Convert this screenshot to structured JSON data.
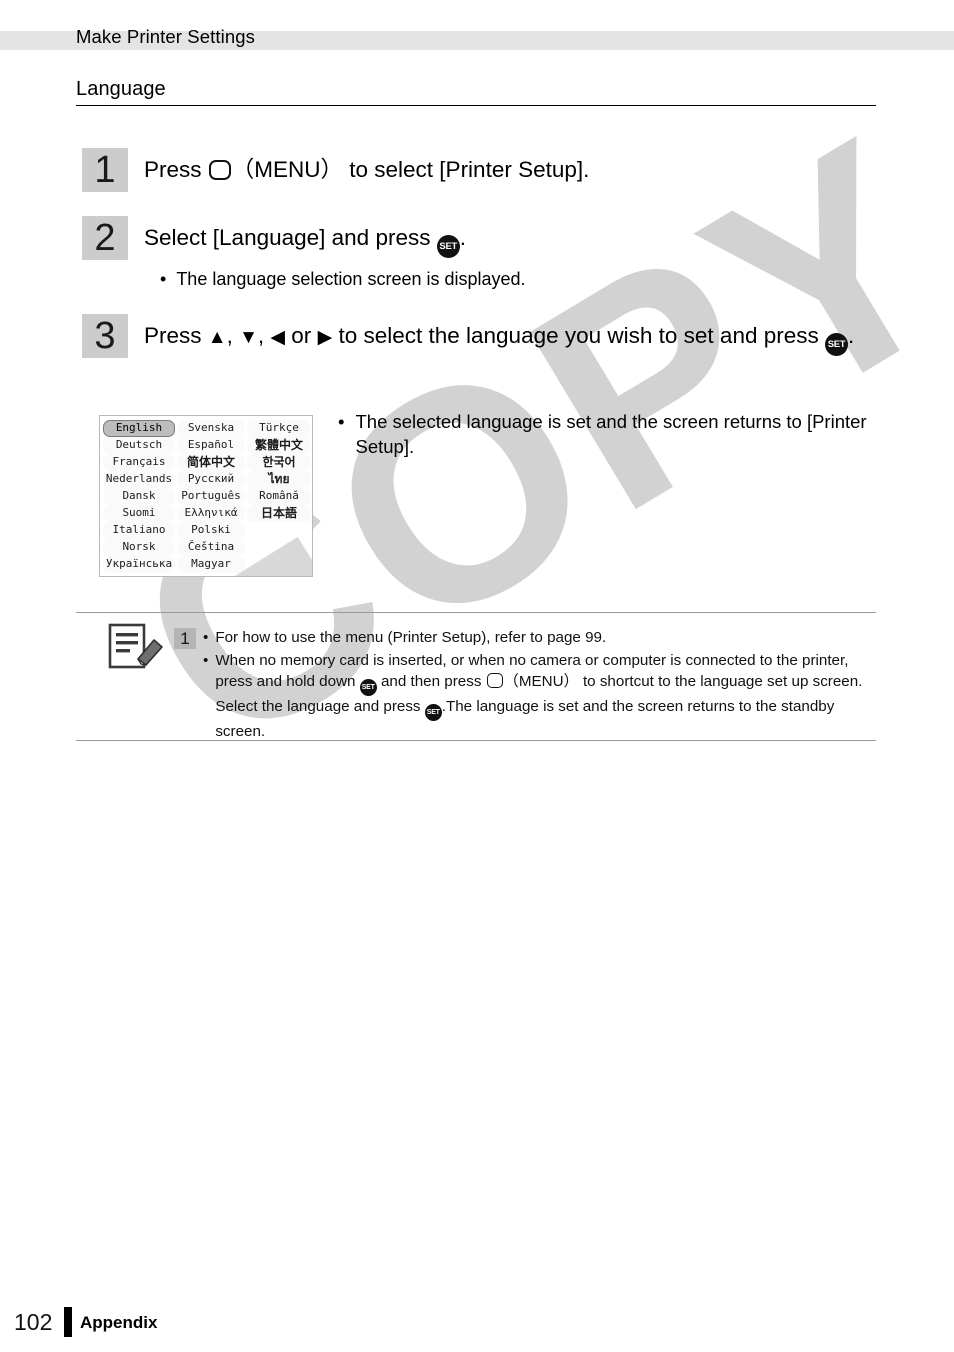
{
  "header": {
    "running_title": "Make Printer Settings"
  },
  "section": {
    "title": "Language"
  },
  "steps": [
    {
      "number": "1",
      "text_before_icon": "Press ",
      "icon": "menu-button-icon",
      "text_after_icon": "（MENU） to select [Printer Setup]."
    },
    {
      "number": "2",
      "text_before_icon": "Select [Language] and press ",
      "icon": "set-button-icon",
      "text_after_icon": ".",
      "bullet": "The language selection screen is displayed."
    },
    {
      "number": "3",
      "text_line1_a": "Press ",
      "arrow_up": "▲",
      "sep1": ", ",
      "arrow_down": "▼",
      "sep2": ", ",
      "arrow_left": "◀",
      "sep3": " or ",
      "arrow_right": "▶",
      "text_line1_b": " to select the language you wish to set and",
      "text_line2_a": "press ",
      "icon": "set-button-icon",
      "text_line2_b": "."
    }
  ],
  "figure": {
    "name": "language-selection-screen",
    "selected_language": "English",
    "columns": [
      [
        "English",
        "Deutsch",
        "Français",
        "Nederlands",
        "Dansk",
        "Suomi",
        "Italiano",
        "Norsk",
        "Українська"
      ],
      [
        "Svenska",
        "Español",
        "简体中文",
        "Русский",
        "Português",
        "Ελληνικά",
        "Polski",
        "Čeština",
        "Magyar"
      ],
      [
        "Türkçe",
        "繁體中文",
        "한국어",
        "ไทย",
        "Română",
        "日本語",
        "",
        "",
        ""
      ]
    ],
    "cjk_flags": [
      [
        false,
        false,
        false,
        false,
        false,
        false,
        false,
        false,
        false
      ],
      [
        false,
        false,
        true,
        false,
        false,
        false,
        false,
        false,
        false
      ],
      [
        false,
        true,
        true,
        true,
        false,
        true,
        false,
        false,
        false
      ]
    ]
  },
  "figure_note": {
    "bullet_symbol": "•",
    "text": "The selected language is set and the screen returns to [Printer Setup]."
  },
  "note_block": {
    "icon": "memo-pencil-icon",
    "badge": "1",
    "bullets": [
      {
        "symbol": "•",
        "parts": [
          {
            "type": "text",
            "value": "For how to use the menu (Printer Setup), refer to page 99."
          }
        ]
      },
      {
        "symbol": "•",
        "parts": [
          {
            "type": "text",
            "value": "When no memory card is inserted, or when no camera or computer is connected to the printer, press and hold down "
          },
          {
            "type": "icon",
            "value": "set-button-icon"
          },
          {
            "type": "text",
            "value": " and then press "
          },
          {
            "type": "icon",
            "value": "menu-button-icon"
          },
          {
            "type": "text",
            "value": "（MENU） to shortcut to the language set up screen. Select the language and press "
          },
          {
            "type": "icon",
            "value": "set-button-icon"
          },
          {
            "type": "text",
            "value": ".The language is set and the screen returns to the standby screen."
          }
        ]
      }
    ]
  },
  "footer": {
    "page_number": "102",
    "label": "Appendix"
  },
  "watermark": {
    "text": "COPY",
    "color": "#d2d2d2"
  },
  "colors": {
    "header_band": "#e4e4e4",
    "step_box": "#cccccc",
    "note_badge": "#b5b5b5",
    "rule": "#9a9a9a",
    "lcd_selected": "#bdbdbd"
  },
  "icons": {
    "set_label": "SET"
  }
}
